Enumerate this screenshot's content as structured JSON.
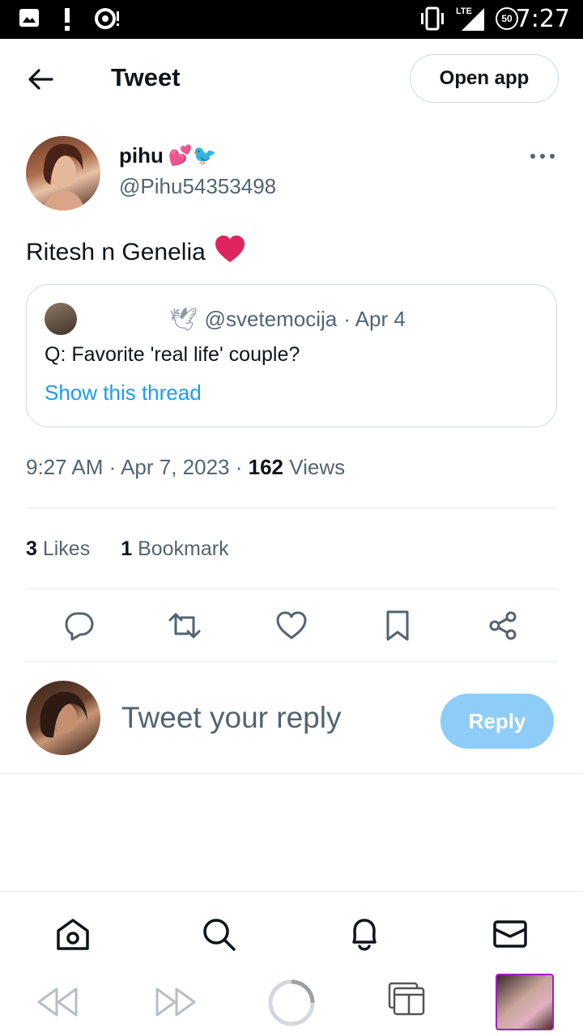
{
  "status_bar": {
    "time": "7:27",
    "network": "LTE",
    "battery": "50"
  },
  "header": {
    "title": "Tweet",
    "open_app_label": "Open app"
  },
  "author": {
    "name": "pihu",
    "name_emojis": "💕🐦",
    "handle": "@Pihu54353498"
  },
  "tweet": {
    "text": "Ritesh n Genelia",
    "text_emoji": "❤",
    "timestamp": "9:27 AM · Apr 7, 2023 · ",
    "views_count": "162",
    "views_label": " Views"
  },
  "quoted_tweet": {
    "name_emoji": "🕊",
    "handle": "@svetemocija",
    "date": "· Apr 4",
    "text": "Q: Favorite 'real life' couple?",
    "link": "Show this thread"
  },
  "stats": {
    "likes_count": "3",
    "likes_label": " Likes",
    "bookmarks_count": "1",
    "bookmarks_label": " Bookmark"
  },
  "reply": {
    "placeholder": "Tweet your reply",
    "button_label": "Reply"
  },
  "icons": {
    "actions": [
      "reply-icon",
      "retweet-icon",
      "like-icon",
      "bookmark-icon",
      "share-icon"
    ],
    "nav": [
      "home-icon",
      "search-icon",
      "notifications-icon",
      "messages-icon"
    ],
    "browser": [
      "back-icon",
      "forward-icon",
      "reload-icon",
      "tabs-icon"
    ]
  },
  "colors": {
    "accent": "#1d9bf0",
    "reply_button": "#8ecdf7",
    "secondary_text": "#536471",
    "heart": "#e0245e"
  }
}
